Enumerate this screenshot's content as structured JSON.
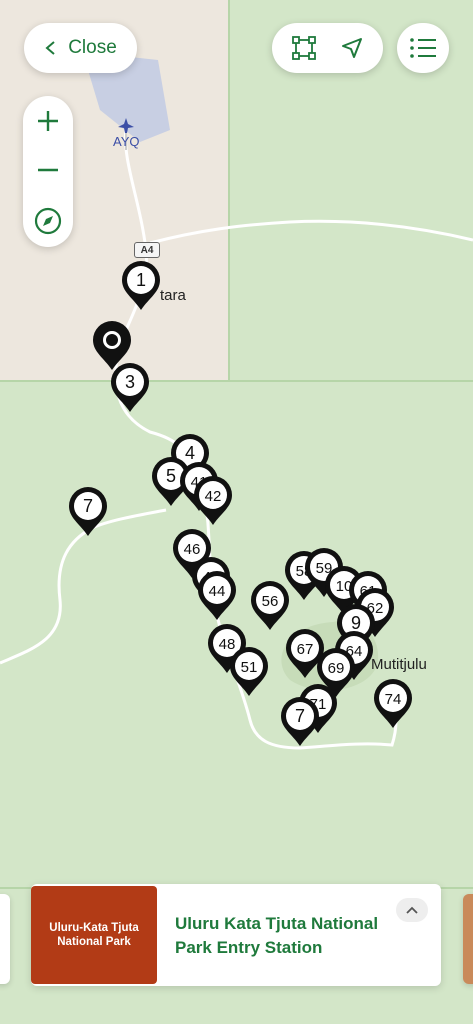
{
  "top_bar": {
    "close_label": "Close",
    "close_icon": "chevron-left-icon",
    "tools": [
      "select-area-icon",
      "navigate-arrow-icon"
    ],
    "list_icon": "list-icon"
  },
  "zoom_controls": [
    "zoom-in-icon",
    "zoom-out-icon",
    "compass-icon"
  ],
  "map": {
    "airport_code": "AYQ",
    "road_label": "A4",
    "place_labels": [
      "tara",
      "Mutitjulu"
    ],
    "colors": {
      "park_green": "#d3e6c8",
      "land": "#ede7de",
      "roads": "#ffffff",
      "accent": "#1f7a3c"
    }
  },
  "markers": [
    {
      "label": "1"
    },
    {
      "label": ""
    },
    {
      "label": "3"
    },
    {
      "label": "4"
    },
    {
      "label": "5"
    },
    {
      "label": "41"
    },
    {
      "label": "42"
    },
    {
      "label": "7"
    },
    {
      "label": "46"
    },
    {
      "label": "49"
    },
    {
      "label": "44"
    },
    {
      "label": "58"
    },
    {
      "label": "59"
    },
    {
      "label": "10"
    },
    {
      "label": "61"
    },
    {
      "label": "62"
    },
    {
      "label": "56"
    },
    {
      "label": "9"
    },
    {
      "label": "64"
    },
    {
      "label": "48"
    },
    {
      "label": "51"
    },
    {
      "label": "67"
    },
    {
      "label": "69"
    },
    {
      "label": "74"
    },
    {
      "label": "71"
    },
    {
      "label": "7"
    }
  ],
  "card": {
    "logo_text": "Uluru-Kata Tjuta National Park",
    "title": "Uluru Kata Tjuta National Park Entry Station",
    "expand_icon": "chevron-up-icon"
  }
}
